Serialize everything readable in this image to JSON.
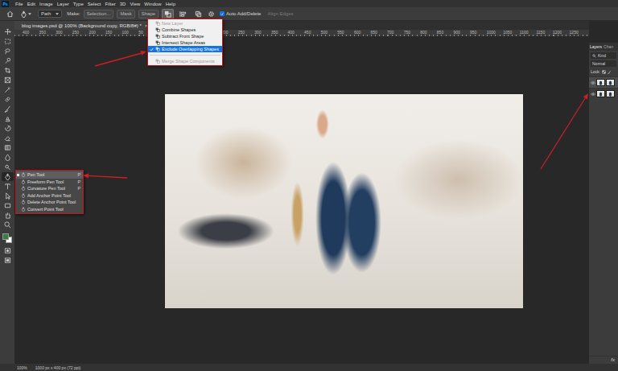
{
  "app": {
    "logo": "Ps"
  },
  "menu_bar": [
    "File",
    "Edit",
    "Image",
    "Layer",
    "Type",
    "Select",
    "Filter",
    "3D",
    "View",
    "Window",
    "Help"
  ],
  "options_bar": {
    "mode": "Path",
    "make_label": "Make:",
    "make_buttons": [
      "Selection...",
      "Mask",
      "Shape"
    ],
    "auto_add_delete": {
      "label": "Auto Add/Delete",
      "checked": true
    },
    "align_edges": {
      "label": "Align Edges",
      "disabled": true
    }
  },
  "path_operations_menu": {
    "open": true,
    "groups": [
      [
        {
          "label": "New Layer",
          "disabled": true,
          "checked": false,
          "selected": false
        },
        {
          "label": "Combine Shapes",
          "disabled": false,
          "checked": false,
          "selected": false
        },
        {
          "label": "Subtract Front Shape",
          "disabled": false,
          "checked": false,
          "selected": false
        },
        {
          "label": "Intersect Shape Areas",
          "disabled": false,
          "checked": false,
          "selected": false
        },
        {
          "label": "Exclude Overlapping Shapes",
          "disabled": false,
          "checked": true,
          "selected": true
        }
      ],
      [
        {
          "label": "Merge Shape Components",
          "disabled": true,
          "checked": false,
          "selected": false
        }
      ]
    ]
  },
  "document_tab": {
    "title": "blog images.psd @ 100% (Background copy, RGB/8#) *",
    "close": "×"
  },
  "ruler": {
    "labels": [
      "400",
      "350",
      "300",
      "250",
      "200",
      "150",
      "100",
      "50",
      "0",
      "50",
      "100",
      "150",
      "200",
      "250",
      "300",
      "350",
      "400",
      "450",
      "500",
      "550",
      "600",
      "650",
      "700",
      "750",
      "800",
      "850",
      "900",
      "950",
      "1000",
      "1050",
      "1100",
      "1150",
      "1200",
      "1250"
    ]
  },
  "toolbar": {
    "tools": [
      {
        "selected": false
      },
      {
        "selected": false
      },
      {
        "selected": false
      },
      {
        "selected": false
      },
      {
        "selected": false
      },
      {
        "selected": false
      },
      {
        "selected": false
      },
      {
        "selected": false
      },
      {
        "selected": false
      },
      {
        "selected": false
      },
      {
        "selected": false
      },
      {
        "selected": false
      },
      {
        "selected": false
      },
      {
        "selected": false
      },
      {
        "selected": false
      },
      {
        "selected": true
      },
      {
        "selected": false
      },
      {
        "selected": false
      },
      {
        "selected": false
      },
      {
        "selected": false
      },
      {
        "selected": false
      }
    ]
  },
  "tool_flyout": {
    "items": [
      {
        "label": "Pen Tool",
        "shortcut": "P",
        "selected": true
      },
      {
        "label": "Freeform Pen Tool",
        "shortcut": "P",
        "selected": false
      },
      {
        "label": "Curvature Pen Tool",
        "shortcut": "P",
        "selected": false
      },
      {
        "label": "Add Anchor Point Tool",
        "selected": false
      },
      {
        "label": "Delete Anchor Point Tool",
        "selected": false
      },
      {
        "label": "Convert Point Tool",
        "selected": false
      }
    ]
  },
  "layers_panel": {
    "tabs": [
      {
        "label": "Layers",
        "selected": true
      },
      {
        "label": "Chan",
        "selected": false
      }
    ],
    "filter": "Kind",
    "blend_mode": "Normal",
    "lock_label": "Lock:",
    "layers": [
      {
        "visible": true,
        "selected": true
      },
      {
        "visible": true,
        "selected": false
      }
    ],
    "footer": "fx"
  },
  "status_bar": {
    "zoom": "100%",
    "doc_info": "1000 px x 400 px (72 ppi)"
  }
}
